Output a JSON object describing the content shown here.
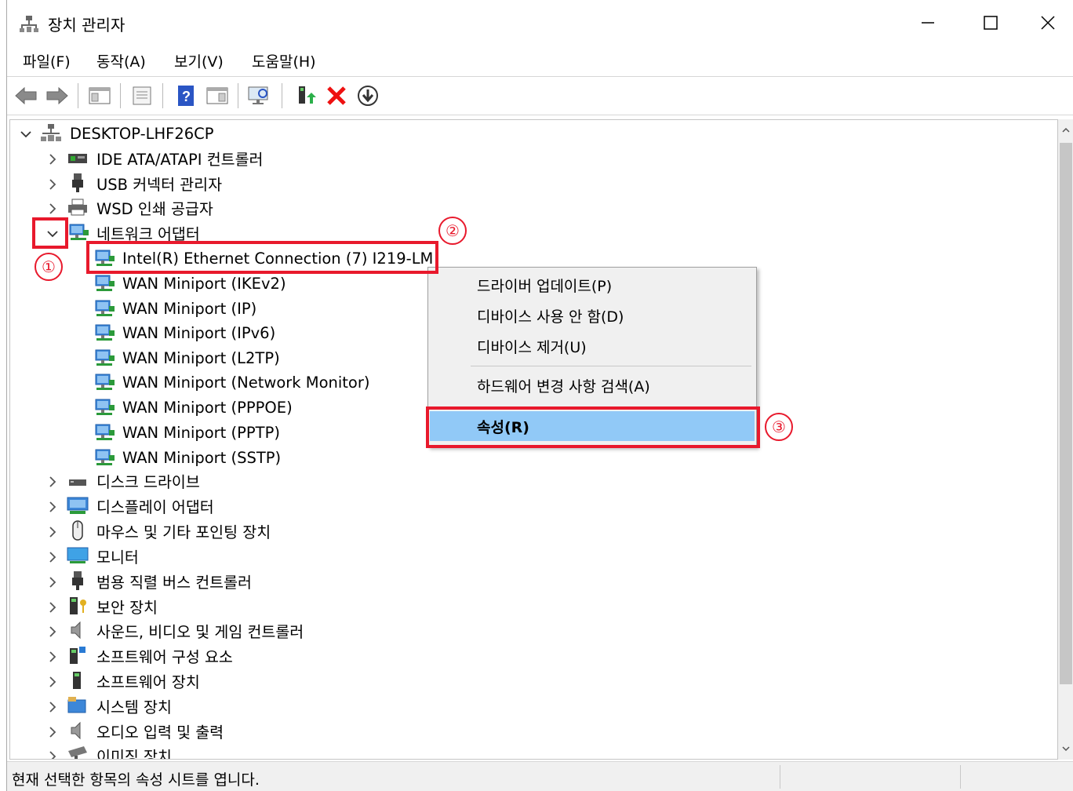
{
  "window": {
    "title": "장치 관리자",
    "controls": {
      "minimize": "minimize-icon",
      "maximize": "maximize-icon",
      "close": "close-icon"
    }
  },
  "menubar": [
    {
      "label": "파일(F)"
    },
    {
      "label": "동작(A)"
    },
    {
      "label": "보기(V)"
    },
    {
      "label": "도움말(H)"
    }
  ],
  "toolbar": {
    "icons": [
      "back-arrow-icon",
      "forward-arrow-icon",
      "console-tree-icon",
      "properties-icon",
      "help-icon",
      "action-pane-icon",
      "scan-hardware-icon",
      "update-driver-icon",
      "uninstall-device-icon",
      "enable-device-icon"
    ]
  },
  "tree": {
    "root": "DESKTOP-LHF26CP",
    "categories": [
      {
        "label": "IDE ATA/ATAPI 컨트롤러",
        "icon": "ide-controller-icon",
        "expanded": false
      },
      {
        "label": "USB 커넥터 관리자",
        "icon": "usb-connector-icon",
        "expanded": false
      },
      {
        "label": "WSD 인쇄 공급자",
        "icon": "printer-icon",
        "expanded": false
      },
      {
        "label": "네트워크 어댑터",
        "icon": "network-adapter-icon",
        "expanded": true,
        "children": [
          "Intel(R) Ethernet Connection (7) I219-LM",
          "WAN Miniport (IKEv2)",
          "WAN Miniport (IP)",
          "WAN Miniport (IPv6)",
          "WAN Miniport (L2TP)",
          "WAN Miniport (Network Monitor)",
          "WAN Miniport (PPPOE)",
          "WAN Miniport (PPTP)",
          "WAN Miniport (SSTP)"
        ]
      },
      {
        "label": "디스크 드라이브",
        "icon": "disk-drive-icon",
        "expanded": false
      },
      {
        "label": "디스플레이 어댑터",
        "icon": "display-adapter-icon",
        "expanded": false
      },
      {
        "label": "마우스 및 기타 포인팅 장치",
        "icon": "mouse-icon",
        "expanded": false
      },
      {
        "label": "모니터",
        "icon": "monitor-icon",
        "expanded": false
      },
      {
        "label": "범용 직렬 버스 컨트롤러",
        "icon": "usb-controller-icon",
        "expanded": false
      },
      {
        "label": "보안 장치",
        "icon": "security-device-icon",
        "expanded": false
      },
      {
        "label": "사운드, 비디오 및 게임 컨트롤러",
        "icon": "speaker-icon",
        "expanded": false
      },
      {
        "label": "소프트웨어 구성 요소",
        "icon": "software-component-icon",
        "expanded": false
      },
      {
        "label": "소프트웨어 장치",
        "icon": "software-device-icon",
        "expanded": false
      },
      {
        "label": "시스템 장치",
        "icon": "system-device-icon",
        "expanded": false
      },
      {
        "label": "오디오 입력 및 출력",
        "icon": "audio-io-icon",
        "expanded": false
      },
      {
        "label": "이미징 장치",
        "icon": "imaging-device-icon",
        "expanded": false
      }
    ]
  },
  "context_menu": {
    "items": [
      {
        "label": "드라이버 업데이트(P)"
      },
      {
        "label": "디바이스 사용 안 함(D)"
      },
      {
        "label": "디바이스 제거(U)"
      },
      {
        "label": "하드웨어 변경 사항 검색(A)"
      },
      {
        "label": "속성(R)",
        "highlighted": true
      }
    ]
  },
  "annotations": [
    {
      "label": "①"
    },
    {
      "label": "②"
    },
    {
      "label": "③"
    }
  ],
  "statusbar": {
    "text": "현재 선택한 항목의 속성 시트를 엽니다."
  },
  "colors": {
    "annotation": "#e8192c",
    "highlight": "#91c9f7",
    "menu_bg": "#f0f0f0"
  }
}
